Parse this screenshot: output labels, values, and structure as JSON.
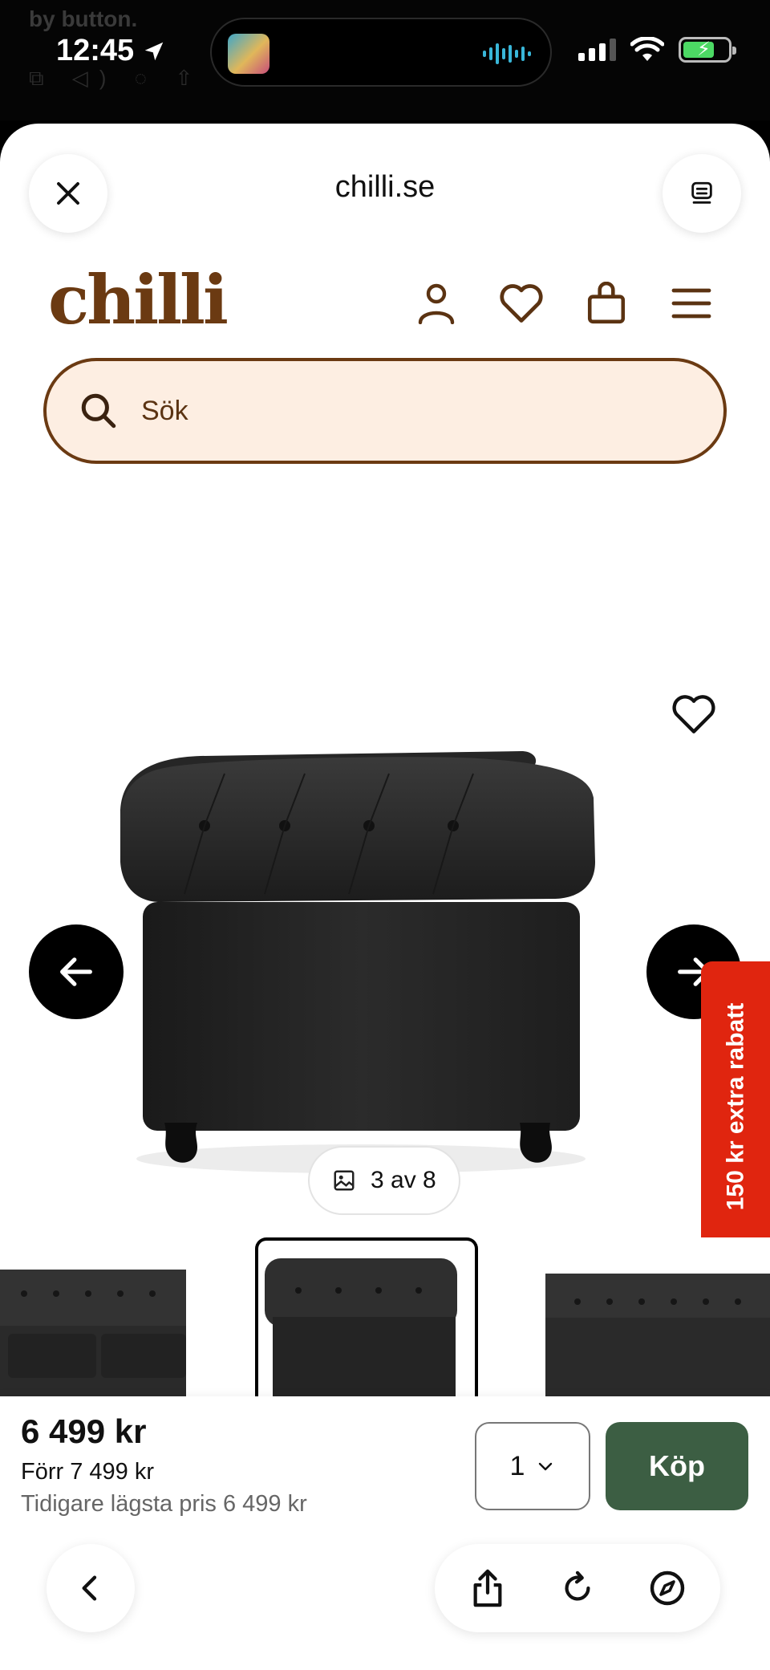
{
  "status_bar": {
    "time": "12:45",
    "behind_text": "by button."
  },
  "sheet": {
    "domain": "chilli.se"
  },
  "site": {
    "logo": "chilli",
    "search_placeholder": "Sök",
    "promo_tab": "150 kr extra rabatt",
    "image_counter": "3 av 8"
  },
  "purchase": {
    "price": "6 499 kr",
    "before_price": "Förr 7 499 kr",
    "lowest_price": "Tidigare lägsta pris 6 499 kr",
    "quantity": "1",
    "buy_label": "Köp"
  },
  "icons": {
    "close": "close-icon",
    "reader": "reader-icon",
    "account": "user-icon",
    "wishlist": "heart-icon",
    "cart": "shopping-bag-icon",
    "menu": "hamburger-menu-icon",
    "search": "search-icon",
    "prev": "arrow-left-icon",
    "next": "arrow-right-icon",
    "gallery": "image-icon",
    "back": "chevron-left-icon",
    "share": "share-icon",
    "reload": "reload-icon",
    "compass": "compass-icon"
  },
  "colors": {
    "brand": "#6b3a12",
    "search_bg": "#fdeee2",
    "buy_button": "#3c5e43",
    "promo": "#e0250f"
  }
}
